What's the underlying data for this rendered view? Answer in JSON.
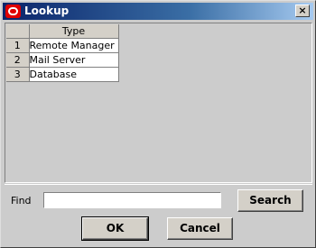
{
  "window": {
    "title": "Lookup",
    "app_icon": "oracle-logo-icon",
    "close_glyph": "×"
  },
  "grid": {
    "column_header": "Type",
    "rows": [
      {
        "num": "1",
        "type": "Remote Manager"
      },
      {
        "num": "2",
        "type": "Mail Server"
      },
      {
        "num": "3",
        "type": "Database"
      }
    ]
  },
  "find": {
    "label": "Find",
    "value": "",
    "placeholder": ""
  },
  "buttons": {
    "search": "Search",
    "ok": "OK",
    "cancel": "Cancel"
  }
}
